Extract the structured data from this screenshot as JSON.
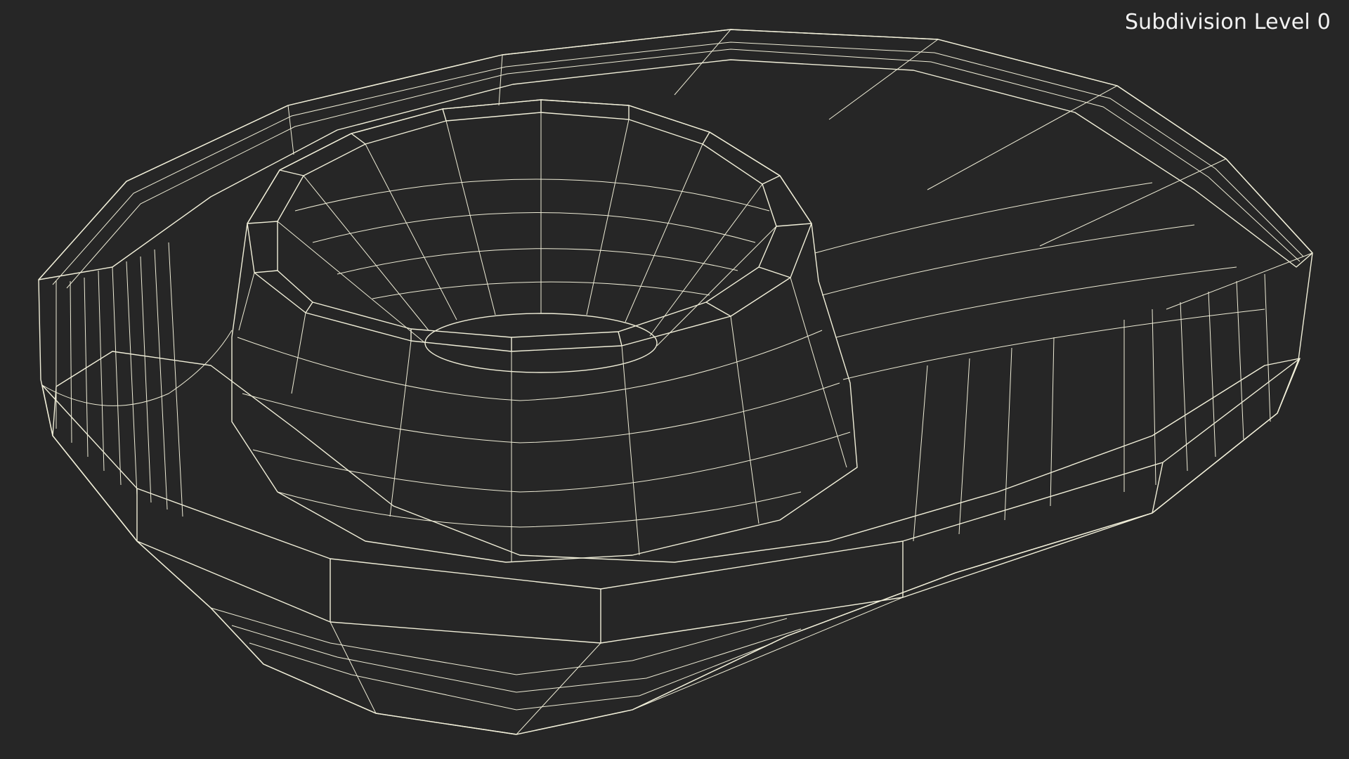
{
  "viewport": {
    "label": "Subdivision Level 0",
    "background_color": "#262626",
    "mesh_color": "#7a7a6e",
    "wire_color": "#f1efd9"
  }
}
